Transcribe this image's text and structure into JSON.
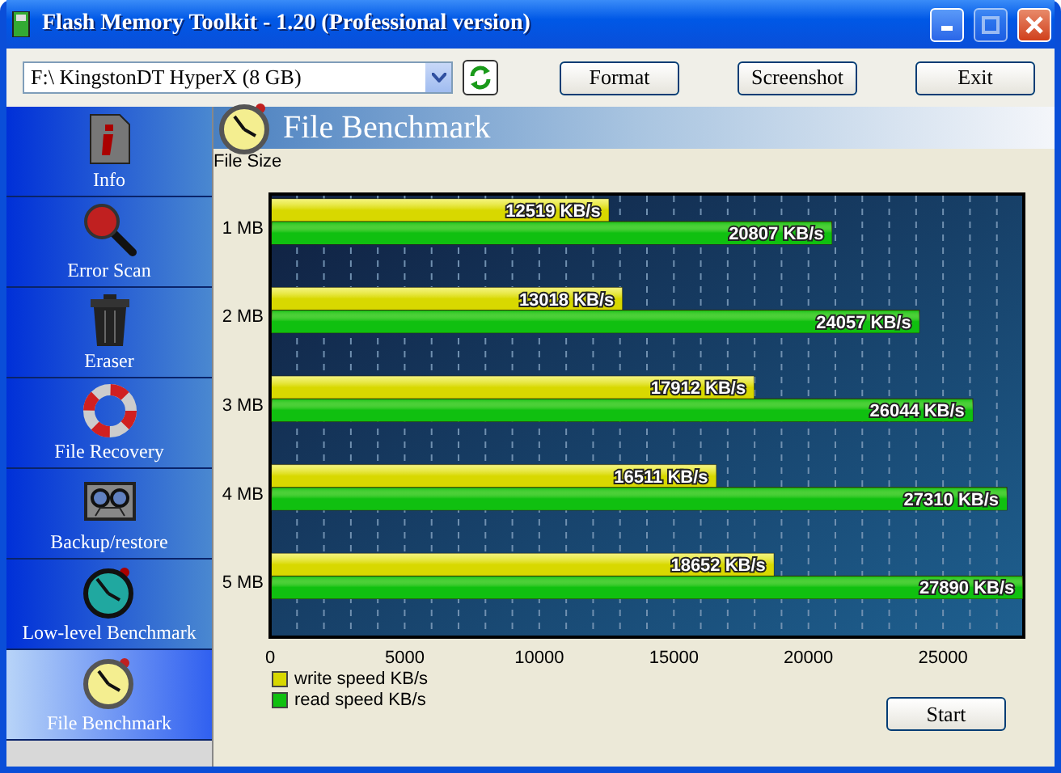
{
  "window": {
    "title": "Flash Memory Toolkit - 1.20 (Professional version)"
  },
  "toolbar": {
    "drive": "F:\\ KingstonDT HyperX (8 GB)",
    "buttons": [
      "Format",
      "Screenshot",
      "Exit"
    ]
  },
  "sidebar": {
    "items": [
      {
        "label": "Info",
        "selected": false
      },
      {
        "label": "Error Scan",
        "selected": false
      },
      {
        "label": "Eraser",
        "selected": false
      },
      {
        "label": "File Recovery",
        "selected": false
      },
      {
        "label": "Backup/restore",
        "selected": false
      },
      {
        "label": "Low-level Benchmark",
        "selected": false
      },
      {
        "label": "File Benchmark",
        "selected": true
      }
    ]
  },
  "panel": {
    "title": "File Benchmark",
    "chart_data": {
      "type": "bar",
      "orientation": "horizontal",
      "ylabel": "File Size",
      "categories": [
        "1 MB",
        "2 MB",
        "3 MB",
        "4 MB",
        "5 MB"
      ],
      "series": [
        {
          "name": "write speed KB/s",
          "color": "#d8d800",
          "values": [
            12519,
            13018,
            17912,
            16511,
            18652
          ],
          "value_labels": [
            "12519 KB/s",
            "13018 KB/s",
            "17912 KB/s",
            "16511 KB/s",
            "18652 KB/s"
          ]
        },
        {
          "name": "read speed KB/s",
          "color": "#10c010",
          "values": [
            20807,
            24057,
            26044,
            27310,
            27890
          ],
          "value_labels": [
            "20807 KB/s",
            "24057 KB/s",
            "26044 KB/s",
            "27310 KB/s",
            "27890 KB/s"
          ]
        }
      ],
      "grid": true,
      "xlim": [
        0,
        28000
      ],
      "xticks": [
        0,
        5000,
        10000,
        15000,
        20000,
        25000
      ]
    },
    "start_button": "Start"
  }
}
